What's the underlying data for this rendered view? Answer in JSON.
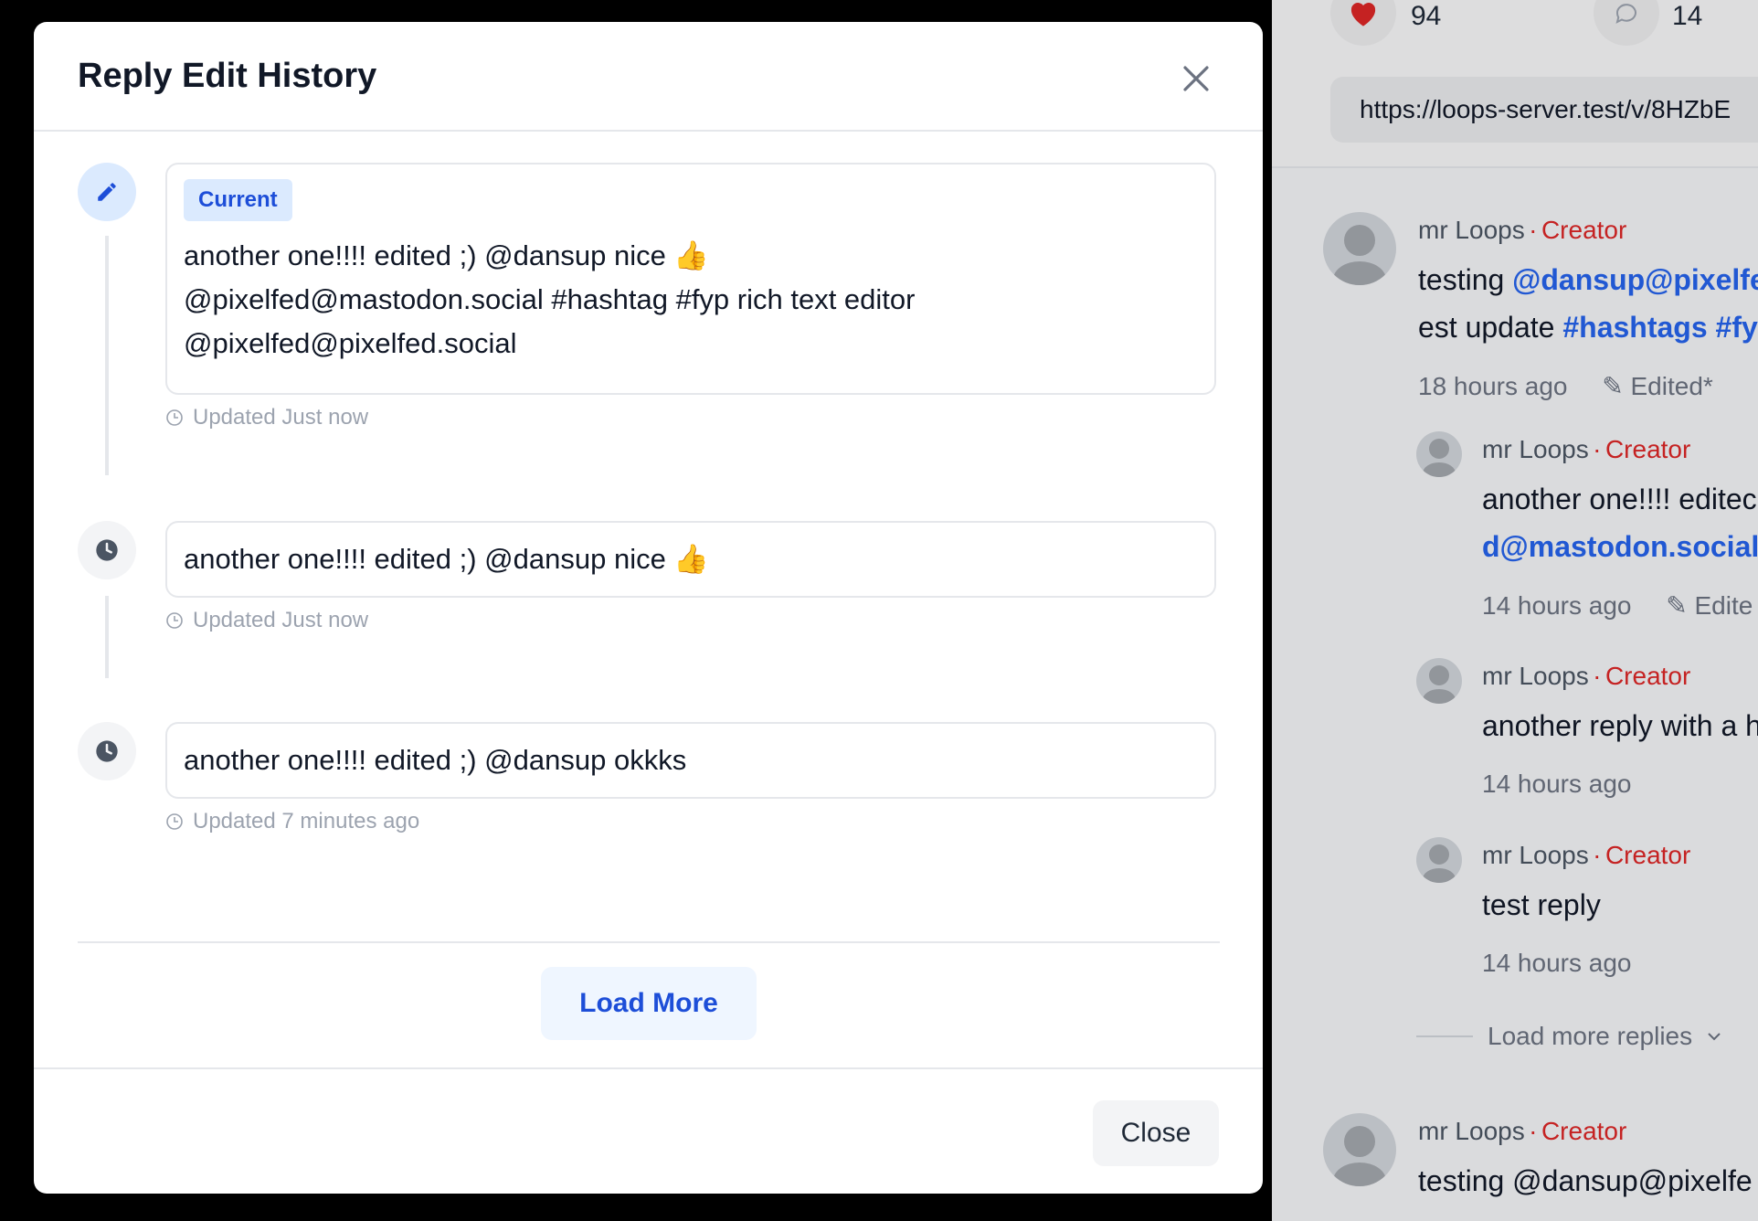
{
  "modal": {
    "title": "Reply Edit History",
    "current_badge": "Current",
    "entries": [
      {
        "lines": [
          "another one!!!! edited ;) @dansup nice 👍",
          "@pixelfed@mastodon.social #hashtag #fyp rich text editor",
          "@pixelfed@pixelfed.social"
        ],
        "updated": "Updated Just now",
        "icon": "pencil-icon",
        "is_current": true
      },
      {
        "lines": [
          "another one!!!! edited ;) @dansup nice 👍"
        ],
        "updated": "Updated Just now",
        "icon": "clock-icon",
        "is_current": false
      },
      {
        "lines": [
          "another one!!!! edited ;) @dansup okkks"
        ],
        "updated": "Updated 7 minutes ago",
        "icon": "clock-icon",
        "is_current": false
      }
    ],
    "load_more_label": "Load More",
    "close_label": "Close"
  },
  "background": {
    "likes": "94",
    "comments": "14",
    "url": "https://loops-server.test/v/8HZbE",
    "comments_list": [
      {
        "name": "mr Loops",
        "sep": "·",
        "role": "Creator",
        "text_plain": "testing ",
        "text_link": "@dansup@pixelfe",
        "text2_plain": "est update ",
        "text2_link": "#hashtags #fy",
        "time": "18 hours ago",
        "edited": "Edited*"
      },
      {
        "name": "mr Loops",
        "sep": "·",
        "role": "Creator",
        "text_plain": "another one!!!! editec",
        "text2_link": "d@mastodon.social",
        "time": "14 hours ago",
        "edited": "Edite"
      },
      {
        "name": "mr Loops",
        "sep": "·",
        "role": "Creator",
        "text_plain": "another reply with a h",
        "time": "14 hours ago"
      },
      {
        "name": "mr Loops",
        "sep": "·",
        "role": "Creator",
        "text_plain": "test reply",
        "time": "14 hours ago"
      },
      {
        "name": "mr Loops",
        "sep": "·",
        "role": "Creator",
        "text_plain": "testing @dansup@pixelfe"
      }
    ],
    "load_more_replies": "Load more replies"
  },
  "colors": {
    "accent": "#1d4ed8",
    "creator": "#dc2626",
    "heart": "#dc2626"
  }
}
